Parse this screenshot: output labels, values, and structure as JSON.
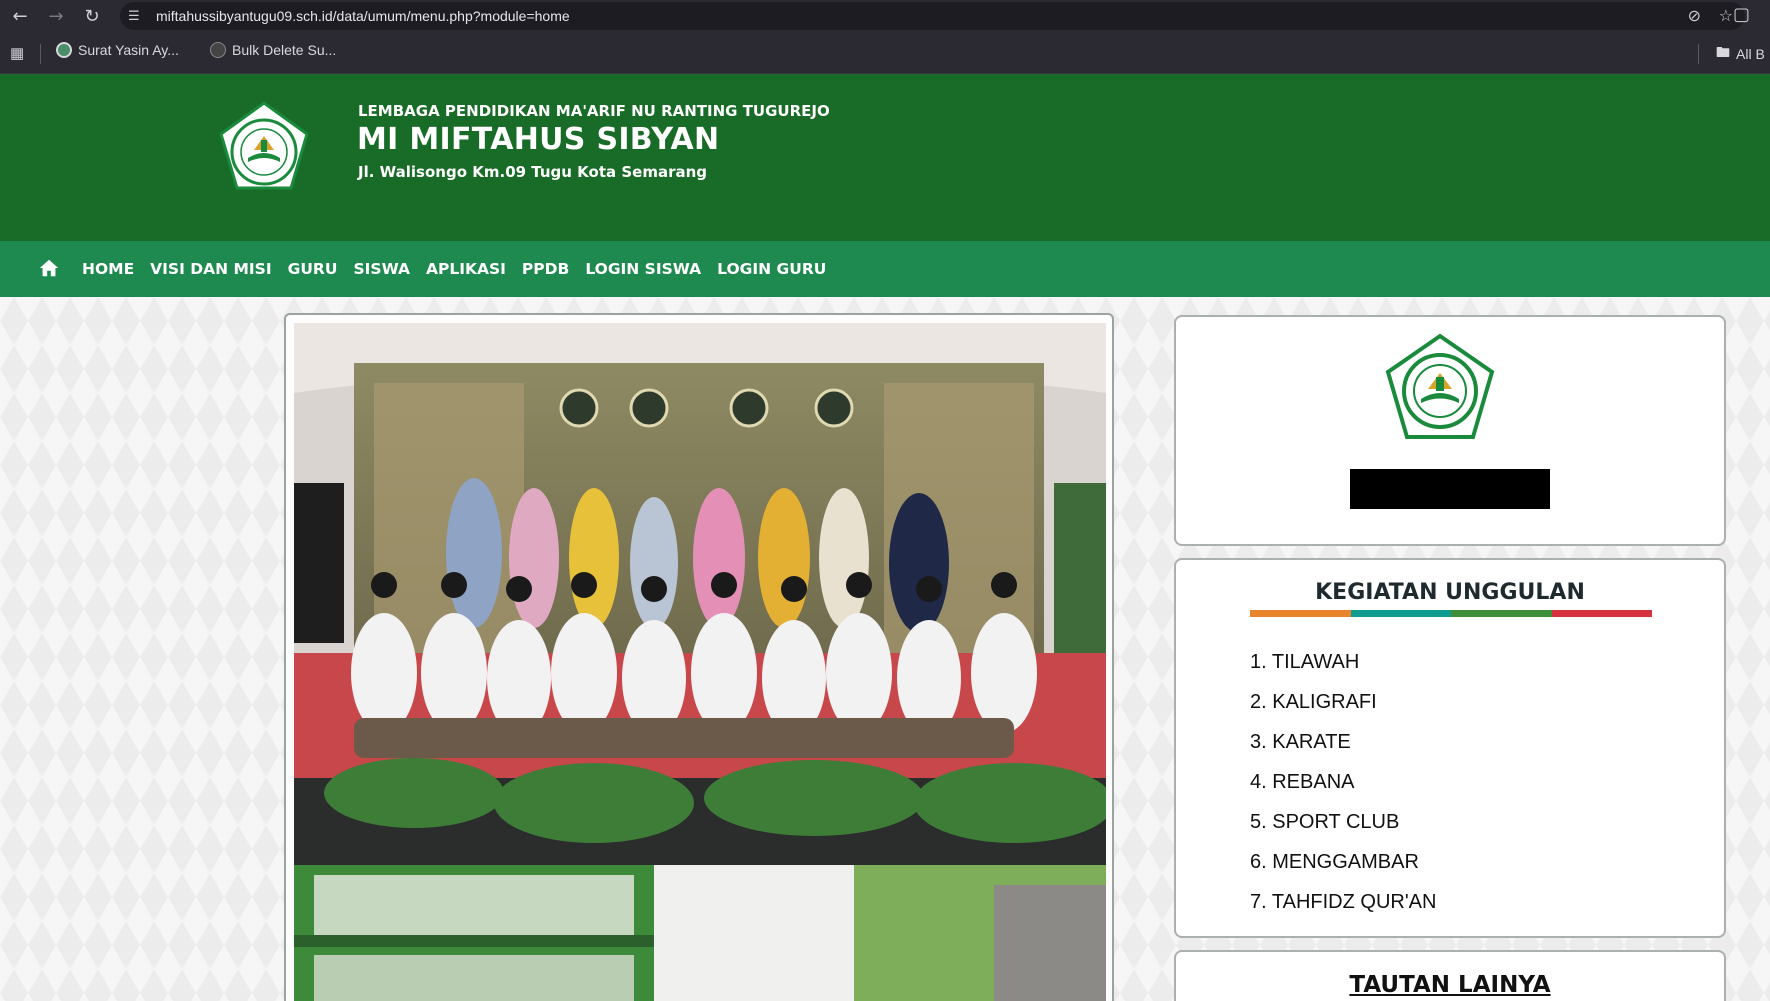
{
  "browser": {
    "url": "miftahussibyantugu09.sch.id/data/umum/menu.php?module=home",
    "bookmarks": [
      {
        "label": "Surat Yasin Ay..."
      },
      {
        "label": "Bulk Delete Su..."
      }
    ],
    "all_bookmarks_label": "All B"
  },
  "header": {
    "subtitle": "LEMBAGA PENDIDIKAN MA'ARIF NU RANTING TUGUREJO",
    "title": "MI MIFTAHUS SIBYAN",
    "address": "Jl. Walisongo Km.09 Tugu Kota Semarang"
  },
  "nav": {
    "items": [
      {
        "label": "HOME"
      },
      {
        "label": "VISI DAN MISI"
      },
      {
        "label": "GURU"
      },
      {
        "label": "SISWA"
      },
      {
        "label": "APLIKASI"
      },
      {
        "label": "PPDB"
      },
      {
        "label": "LOGIN SISWA"
      },
      {
        "label": "LOGIN GURU"
      }
    ]
  },
  "kegiatan": {
    "title": "KEGIATAN UNGGULAN",
    "bar_colors": [
      "#e8842c",
      "#0f9b8e",
      "#3f8f3a",
      "#d6323d"
    ],
    "items": [
      "1. TILAWAH",
      "2. KALIGRAFI",
      "3. KARATE",
      "4. REBANA",
      "5. SPORT CLUB",
      "6. MENGGAMBAR",
      "7. TAHFIDZ QUR'AN"
    ]
  },
  "tautan": {
    "title": "TAUTAN LAINYA"
  },
  "colors": {
    "header_green": "#196b28",
    "nav_green": "#1f8a4f"
  }
}
